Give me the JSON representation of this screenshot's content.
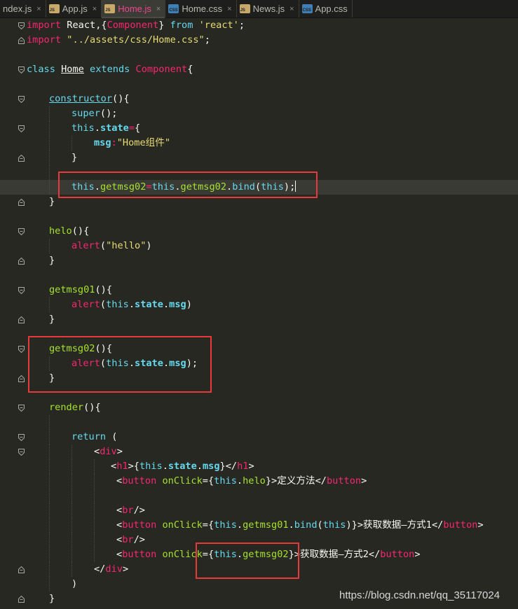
{
  "tabs": [
    {
      "label": "ndex.js",
      "icon": "js-file-icon",
      "active": false
    },
    {
      "label": "App.js",
      "icon": "js-file-icon",
      "active": false
    },
    {
      "label": "Home.js",
      "icon": "js-file-icon",
      "active": true
    },
    {
      "label": "Home.css",
      "icon": "css-file-icon",
      "active": false
    },
    {
      "label": "News.js",
      "icon": "js-file-icon",
      "active": false
    },
    {
      "label": "App.css",
      "icon": "css-file-icon",
      "active": false
    }
  ],
  "tab_close_glyph": "×",
  "colors": {
    "background": "#272822",
    "keyword": "#66d9ef",
    "tag": "#f92672",
    "string": "#e6db74",
    "annotation_box": "#e83a3a",
    "active_tab": "#f0468d"
  },
  "code": {
    "l1": {
      "a": "import",
      "b": " React,{",
      "c": "Component",
      "d": "} ",
      "e": "from",
      "f": " ",
      "g": "'react'",
      "h": ";"
    },
    "l2": {
      "a": "import",
      "b": " ",
      "c": "\"../assets/css/Home.css\"",
      "d": ";"
    },
    "l4": {
      "a": "class",
      "b": " ",
      "c": "Home",
      "d": " ",
      "e": "extends",
      "f": " ",
      "g": "Component",
      "h": "{"
    },
    "l6": {
      "a": "constructor",
      "b": "(){"
    },
    "l7": {
      "a": "super",
      "b": "();"
    },
    "l8": {
      "a": "this",
      "b": ".",
      "c": "state",
      "d": "=",
      "e": "{"
    },
    "l9": {
      "a": "msg",
      "b": ":",
      "c": "\"Home组件\""
    },
    "l10": {
      "a": "}"
    },
    "l12": {
      "a": "this",
      "b": ".",
      "c": "getmsg02",
      "d": "=",
      "e": "this",
      "f": ".",
      "g": "getmsg02",
      "h": ".",
      "i": "bind",
      "j": "(",
      "k": "this",
      "l": ");"
    },
    "l13": {
      "a": "}"
    },
    "l15": {
      "a": "helo",
      "b": "(){"
    },
    "l16": {
      "a": "alert",
      "b": "(",
      "c": "\"hello\"",
      "d": ")"
    },
    "l17": {
      "a": "}"
    },
    "l19": {
      "a": "getmsg01",
      "b": "(){"
    },
    "l20": {
      "a": "alert",
      "b": "(",
      "c": "this",
      "d": ".",
      "e": "state",
      "f": ".",
      "g": "msg",
      "h": ")"
    },
    "l21": {
      "a": "}"
    },
    "l23": {
      "a": "getmsg02",
      "b": "(){"
    },
    "l24": {
      "a": "alert",
      "b": "(",
      "c": "this",
      "d": ".",
      "e": "state",
      "f": ".",
      "g": "msg",
      "h": ");"
    },
    "l25": {
      "a": "}"
    },
    "l27": {
      "a": "render",
      "b": "(){"
    },
    "l29": {
      "a": "return",
      "b": " ("
    },
    "l30": {
      "a": "<",
      "b": "div",
      "c": ">"
    },
    "l31": {
      "a": "<",
      "b": "h1",
      "c": ">{",
      "d": "this",
      "e": ".",
      "f": "state",
      "g": ".",
      "h": "msg",
      "i": "}</",
      "j": "h1",
      "k": ">"
    },
    "l32": {
      "a": "<",
      "b": "button",
      "c": " ",
      "d": "onClick",
      "e": "={",
      "f": "this",
      "g": ".",
      "h": "helo",
      "i": "}>",
      "j": "定义方法",
      "k": "</",
      "l": "button",
      "m": ">"
    },
    "l34": {
      "a": "<",
      "b": "br",
      "c": "/>"
    },
    "l35": {
      "a": "<",
      "b": "button",
      "c": " ",
      "d": "onClick",
      "e": "={",
      "f": "this",
      "g": ".",
      "h": "getmsg01",
      "i": ".",
      "j": "bind",
      "k": "(",
      "l": "this",
      "m": ")}>",
      "n": "获取数据—方式1",
      "o": "</",
      "p": "button",
      "q": ">"
    },
    "l36": {
      "a": "<",
      "b": "br",
      "c": "/>"
    },
    "l37": {
      "a": "<",
      "b": "button",
      "c": " ",
      "d": "onClick",
      "e": "={",
      "f": "this",
      "g": ".",
      "h": "getmsg02",
      "i": "}>",
      "j": "获取数据—方式2",
      "k": "</",
      "l": "button",
      "m": ">"
    },
    "l38": {
      "a": "</",
      "b": "div",
      "c": ">"
    },
    "l39": {
      "a": ")"
    },
    "l40": {
      "a": "}"
    }
  },
  "watermark": "https://blog.csdn.net/qq_35117024"
}
